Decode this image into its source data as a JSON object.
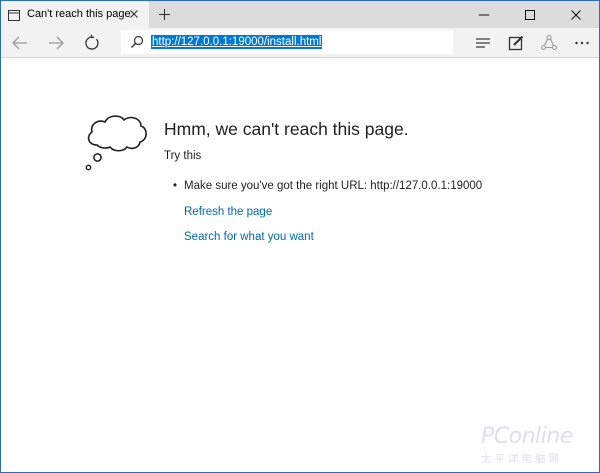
{
  "tab": {
    "title": "Can't reach this page"
  },
  "address_bar": {
    "url": "http://127.0.0.1:19000/install.html"
  },
  "error_page": {
    "heading": "Hmm, we can't reach this page.",
    "try_this": "Try this",
    "suggestions": [
      {
        "text": "Make sure you've got the right URL: http://127.0.0.1:19000",
        "is_link": false
      },
      {
        "text": "Refresh the page",
        "is_link": true
      },
      {
        "text": "Search for what you want",
        "is_link": true
      }
    ]
  },
  "watermark": {
    "brand": "PConline",
    "subtitle": "太平洋电脑网"
  },
  "colors": {
    "window_border": "#2b6cc4",
    "tabstrip_bg": "#dcdcdc",
    "active_tab_bg": "#f2f2f2",
    "url_highlight": "#0078d7",
    "link": "#0067b8",
    "text": "#1f1f1f"
  },
  "icons": {
    "tab": "page-icon",
    "tab_close": "close-icon",
    "new_tab": "plus-icon",
    "minimize": "minimize-icon",
    "maximize": "maximize-icon",
    "window_close": "close-icon",
    "back": "back-arrow-icon",
    "forward": "forward-arrow-icon",
    "refresh": "refresh-icon",
    "search": "search-icon",
    "hub": "hub-icon",
    "web_note": "web-note-icon",
    "share": "share-icon",
    "more": "more-icon",
    "error_illustration": "thought-cloud-icon"
  }
}
